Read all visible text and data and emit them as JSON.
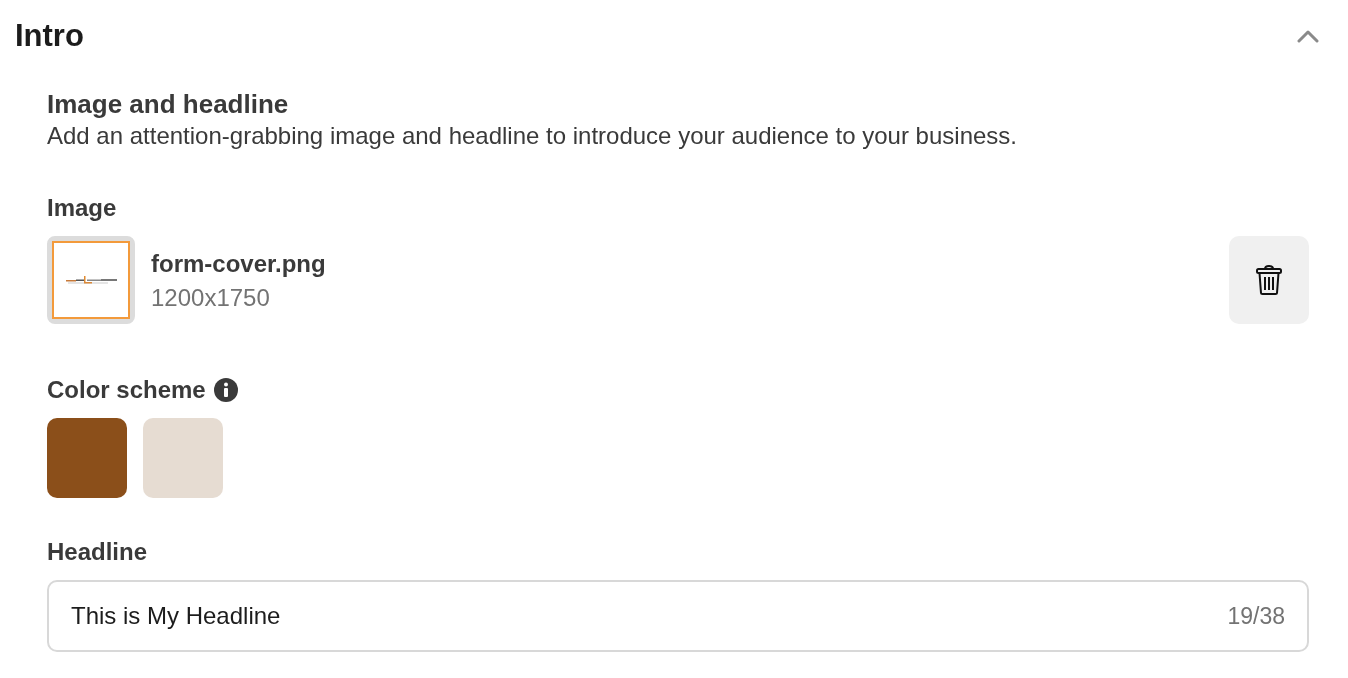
{
  "section": {
    "title": "Intro",
    "expanded": true
  },
  "subsection": {
    "title": "Image and headline",
    "description": "Add an attention-grabbing image and headline to introduce your audience to your business."
  },
  "image": {
    "label": "Image",
    "filename": "form-cover.png",
    "dimensions": "1200x1750"
  },
  "color_scheme": {
    "label": "Color scheme",
    "swatches": [
      {
        "color": "#8b4f1a"
      },
      {
        "color": "#e6dcd2"
      }
    ]
  },
  "headline": {
    "label": "Headline",
    "value": "This is My Headline",
    "counter": "19/38"
  }
}
